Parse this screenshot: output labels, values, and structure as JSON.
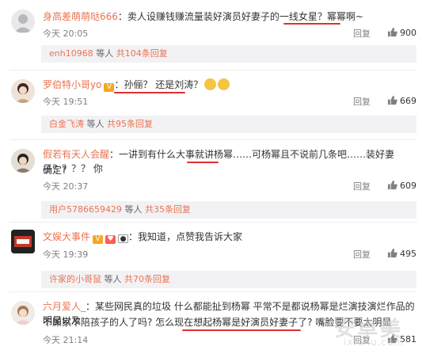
{
  "comments": [
    {
      "username": "身高差萌萌哒666",
      "text": "卖人设赚钱赚流量装好演员好妻子的一线女星？幂幂啊~",
      "time": "今天 20:05",
      "reply_label": "回复",
      "likes": "900",
      "sub": {
        "who": "enh10968",
        "mid": " 等人 ",
        "count": "共104条回复"
      }
    },
    {
      "username": "罗伯特小哥yo",
      "text": "孙俪？ 还是刘涛？",
      "time": "今天 19:51",
      "reply_label": "回复",
      "likes": "669",
      "sub": {
        "who": "白金飞涛",
        "mid": " 等人 ",
        "count": "共95条回复"
      }
    },
    {
      "username": "假若有天人会醒",
      "text": "一讲到有什么大事就讲杨幂……可杨幂且不说前几条吧……装好妻子？？？？ 你",
      "text2": "确定?",
      "time": "今天 20:37",
      "reply_label": "回复",
      "likes": "609",
      "sub": {
        "who": "用户5786659429",
        "mid": " 等人 ",
        "count": "共35条回复"
      }
    },
    {
      "username": "文娱大事件",
      "text": "我知道，点赞我告诉大家",
      "time": "今天 19:39",
      "reply_label": "回复",
      "likes": "495",
      "sub": {
        "who": "许家的小哥鼠",
        "mid": " 等人 ",
        "count": "共70条回复"
      }
    },
    {
      "username": "六月爱人_",
      "text": "某些网民真的垃圾 什么都能扯到杨幂 平常不是都说杨幂是烂演技演烂作品的明星以及",
      "text2": "不顾家不陪孩子的人了吗? 怎么现在想起杨幂是好演员好妻子了? 嘴脸要不要太明显",
      "time": "今天 21:14",
      "reply_label": "回复",
      "likes": "581"
    }
  ],
  "watermark": {
    "big": "安卓美",
    "small": "ixiunu.com"
  },
  "colors": {
    "accent": "#eb7350",
    "underline": "#e03030",
    "subbox_bg": "#f2f2f5"
  }
}
